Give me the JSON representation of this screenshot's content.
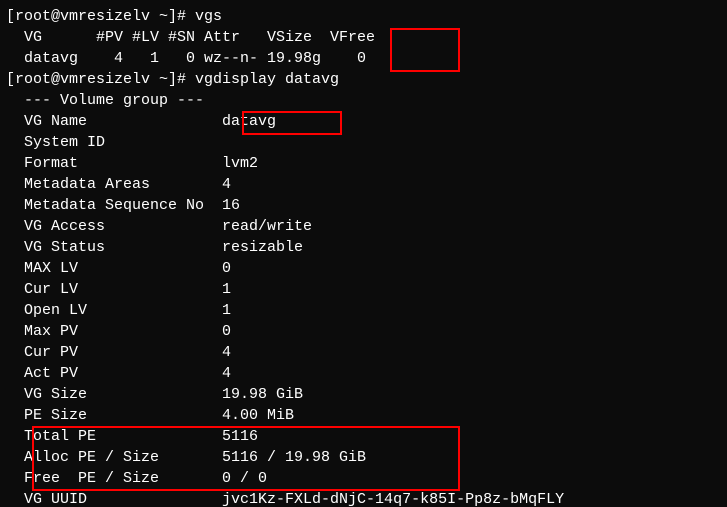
{
  "prompt1": "[root@vmresizelv ~]# ",
  "cmd1": "vgs",
  "vgs_header": "  VG      #PV #LV #SN Attr   VSize  VFree",
  "vgs_row": "  datavg    4   1   0 wz--n- 19.98g    0 ",
  "prompt2": "[root@vmresizelv ~]# ",
  "cmd2": "vgdisplay datavg",
  "vol_group_sep": "  --- Volume group ---",
  "rows": {
    "vg_name": "  VG Name               datavg",
    "system_id": "  System ID             ",
    "format": "  Format                lvm2",
    "meta_areas": "  Metadata Areas        4",
    "meta_seq": "  Metadata Sequence No  16",
    "vg_access": "  VG Access             read/write",
    "vg_status": "  VG Status             resizable",
    "max_lv": "  MAX LV                0",
    "cur_lv": "  Cur LV                1",
    "open_lv": "  Open LV               1",
    "max_pv": "  Max PV                0",
    "cur_pv": "  Cur PV                4",
    "act_pv": "  Act PV                4",
    "vg_size": "  VG Size               19.98 GiB",
    "pe_size": "  PE Size               4.00 MiB",
    "total_pe": "  Total PE              5116",
    "alloc_pe": "  Alloc PE / Size       5116 / 19.98 GiB",
    "free_pe": "  Free  PE / Size       0 / 0",
    "vg_uuid": "  VG UUID               jvc1Kz-FXLd-dNjC-14q7-k85I-Pp8z-bMqFLY"
  },
  "highlights": {
    "vfree_box": "VFree / 0",
    "datavg_box": "datavg",
    "pe_box": "Total/Alloc/Free PE"
  }
}
